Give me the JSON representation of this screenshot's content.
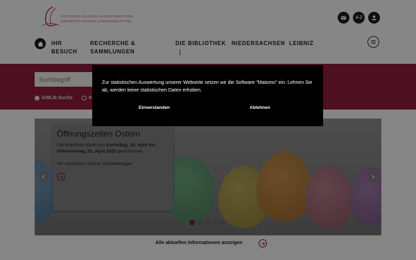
{
  "header": {
    "logo_line1": "GOTTFRIED WILHELM LEIBNIZ BIBLIOTHEK",
    "logo_line2": "NIEDERSÄCHSISCHE LANDESBIBLIOTHEK",
    "az_label": "A-Z",
    "nav": [
      {
        "label": "IHR BESUCH"
      },
      {
        "label": "RECHERCHE & SAMMLUNGEN"
      },
      {
        "label": "DIE BIBLIOTHEK"
      },
      {
        "label": "NIEDERSACHSEN"
      },
      {
        "label": "LEIBNIZ"
      }
    ]
  },
  "search": {
    "placeholder": "Suchbegriff",
    "options": [
      {
        "label": "GWLB-Suche",
        "checked": true
      },
      {
        "label": "K",
        "checked": false
      }
    ]
  },
  "slider": {
    "title": "Öffnungszeiten Ostern",
    "text_prefix": "Die Bibliothek bleibt von ",
    "text_bold1": "Karfreitag, 18. April bis Ostermontag, 21. April 2025",
    "text_suffix": " geschlossen.",
    "text2": "Wir wünschen schöne Osterfeiertage!",
    "active_slide": 1,
    "slide_count": 5
  },
  "all_info_label": "Alle aktuellen Informationen anzeigen",
  "consent": {
    "text": "Zur statistischen Auswertung unserer Webseite setzen wir die Software \"Matomo\" ein. Lehnen Sie ab, werden keine statistischen Daten erhoben.",
    "accept_label": "Einverstanden",
    "decline_label": "Ablehnen"
  },
  "colors": {
    "brand": "#c2185b",
    "dark": "#1d1d1d"
  }
}
